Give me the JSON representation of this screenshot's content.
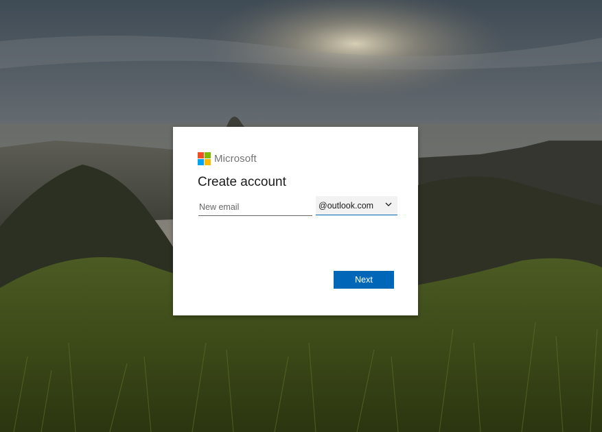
{
  "background": {
    "description_colors": {
      "sky_top": "#4e5c66",
      "sky_glow": "#c9b896",
      "hills": "#2f3226",
      "grass": "#4d5a22"
    }
  },
  "dialog": {
    "brand": {
      "logo_text": "Microsoft",
      "squares": {
        "red": "#f25022",
        "green": "#7fba00",
        "blue": "#00a4ef",
        "yellow": "#ffb900"
      }
    },
    "title": "Create account",
    "email": {
      "placeholder": "New email",
      "value": ""
    },
    "domain": {
      "selected": "@outlook.com",
      "icon": "chevron-down-icon"
    },
    "next_label": "Next",
    "accent": "#0067b8"
  }
}
